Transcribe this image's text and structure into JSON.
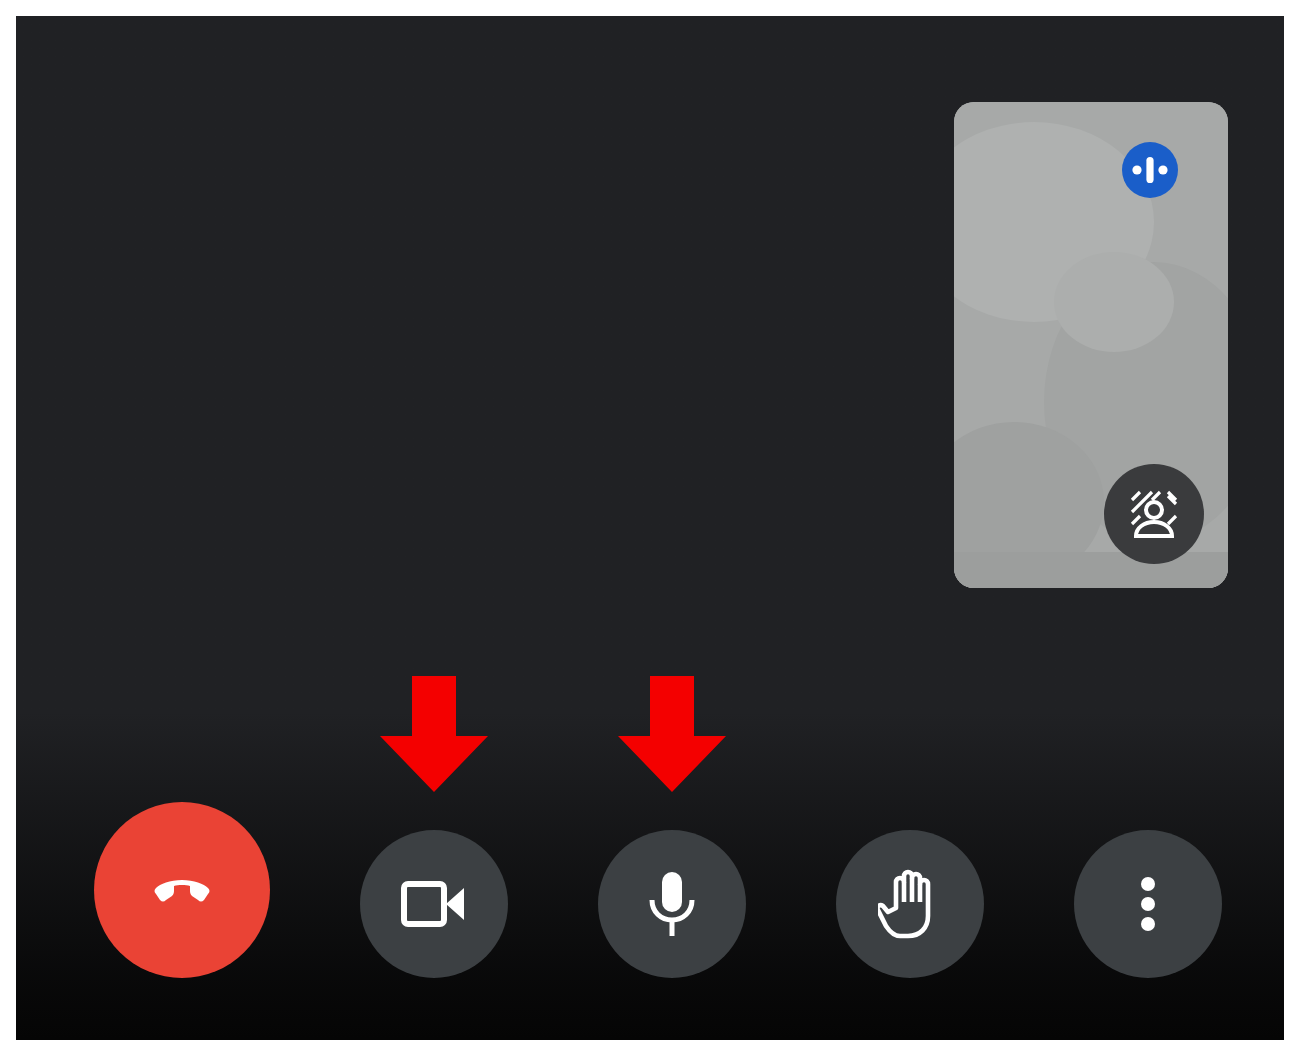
{
  "self_view": {
    "kind": "picture",
    "speaking": true,
    "effects_button": true
  },
  "controls": [
    {
      "kind": "end_call",
      "annotated": false
    },
    {
      "kind": "camera",
      "annotated": true
    },
    {
      "kind": "mic",
      "annotated": true
    },
    {
      "kind": "raise_hand",
      "annotated": false
    },
    {
      "kind": "more",
      "annotated": false
    }
  ]
}
